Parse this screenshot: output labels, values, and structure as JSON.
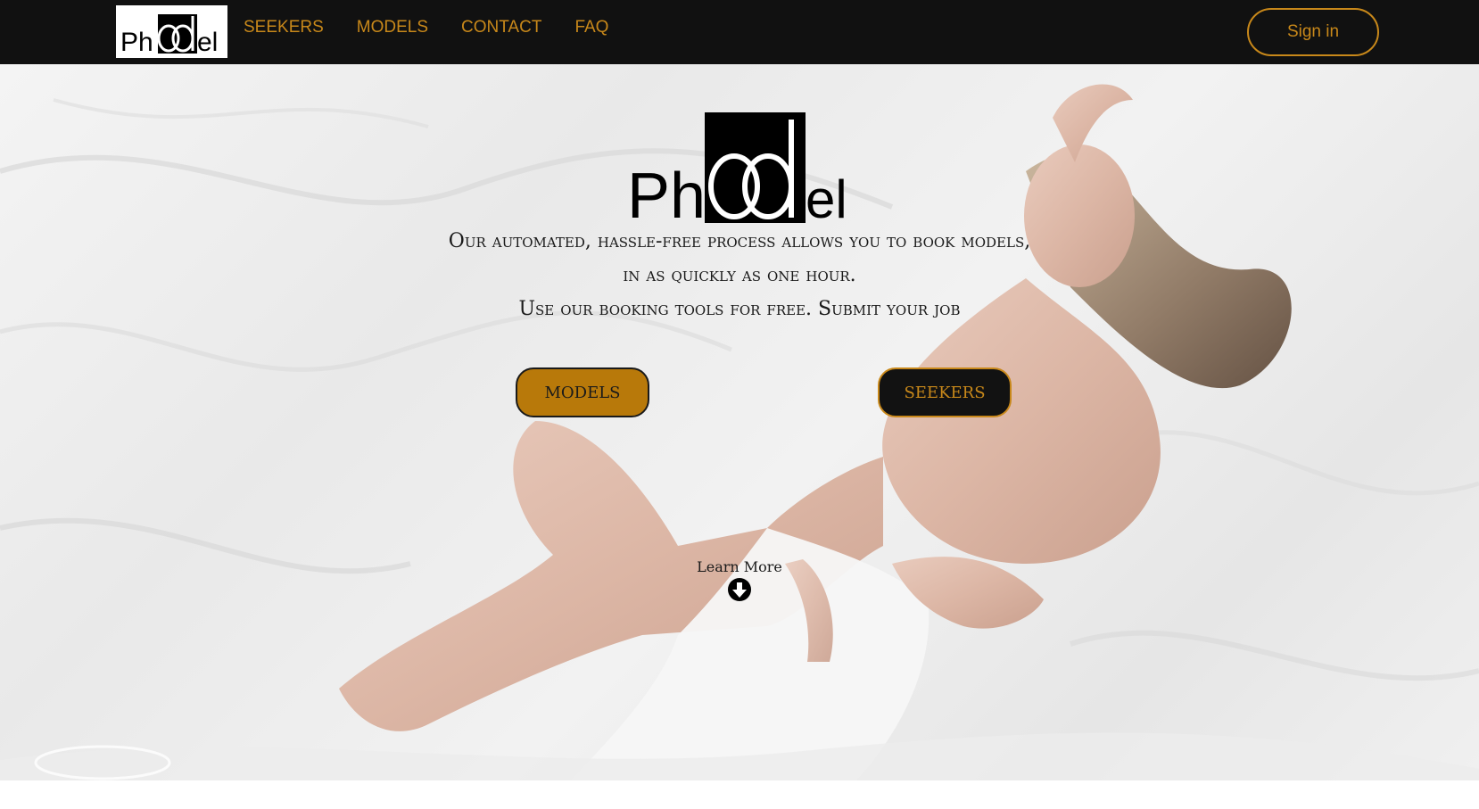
{
  "nav": {
    "brand": "Phoodel",
    "links": [
      "SEEKERS",
      "MODELS",
      "CONTACT",
      "FAQ"
    ],
    "signin_label": "Sign in"
  },
  "hero": {
    "logo_text": "Phoodel",
    "tagline_line1": "Our automated, hassle-free process allows you to book models,",
    "tagline_line2": "in as quickly as one hour.",
    "tagline_line3": "Use our booking tools for free. Submit your job",
    "models_button": "MODELS",
    "seekers_button": "SEEKERS",
    "learn_more": "Learn More",
    "background_image": "photo-model-reclining-on-white-sheets"
  },
  "colors": {
    "accent": "#c8881a",
    "models_button_bg": "#b8790a",
    "navbar_bg": "#111111"
  },
  "icons": {
    "learn_more": "arrow-down-circle-icon"
  }
}
